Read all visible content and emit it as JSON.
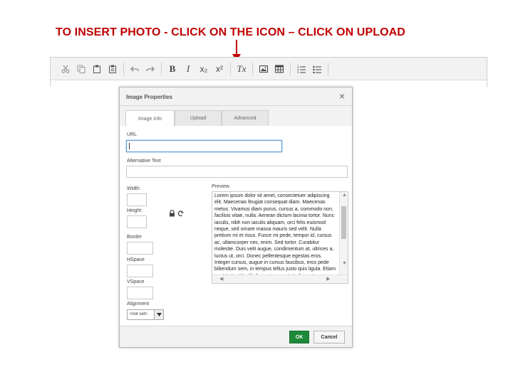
{
  "slide": {
    "title": "TO INSERT PHOTO  - CLICK ON THE ICON – CLICK ON UPLOAD"
  },
  "colors": {
    "title": "#c00000",
    "ok_button": "#1e8a3a",
    "focus_border": "#5b9bd5"
  },
  "toolbar": {
    "bold_label": "B",
    "italic_label": "I",
    "subscript_label": "x₂",
    "superscript_label": "x²",
    "clear_format_label": "Tx"
  },
  "dialog": {
    "title": "Image Properties",
    "close_glyph": "×",
    "tabs": [
      {
        "label": "Image Info",
        "active": true
      },
      {
        "label": "Upload",
        "active": false
      },
      {
        "label": "Advanced",
        "active": false
      }
    ],
    "url": {
      "label": "URL",
      "value": ""
    },
    "alt": {
      "label": "Alternative Text",
      "value": ""
    },
    "width": {
      "label": "Width",
      "value": ""
    },
    "height": {
      "label": "Height",
      "value": ""
    },
    "border": {
      "label": "Border",
      "value": ""
    },
    "hspace": {
      "label": "HSpace",
      "value": ""
    },
    "vspace": {
      "label": "VSpace",
      "value": ""
    },
    "alignment": {
      "label": "Alignment",
      "value": "<not set>"
    },
    "preview": {
      "label": "Preview",
      "text": "Lorem ipsum dolor sit amet, consectetuer adipiscing elit. Maecenas feugiat consequat diam. Maecenas metus. Vivamus diam purus, cursus a, commodo non, facilisis vitae, nulla. Aenean dictum lacinia tortor. Nunc iaculis, nibh non iaculis aliquam, orci felis euismod neque, sed ornare massa mauris sed velit. Nulla pretium mi et risus. Fusce mi pede, tempor id, cursus ac, ullamcorper nec, enim. Sed tortor. Curabitur molestie. Duis velit augue, condimentum at, ultrices a, luctus ut, orci. Donec pellentesque egestas eros. Integer cursus, augue in cursus faucibus, eros pede bibendum sem, in tempus tellus justo quis ligula. Etiam eget tortor. Vestibulum rutrum, est ut placerat elementum, lectus"
    },
    "ok_label": "OK",
    "cancel_label": "Cancel"
  }
}
